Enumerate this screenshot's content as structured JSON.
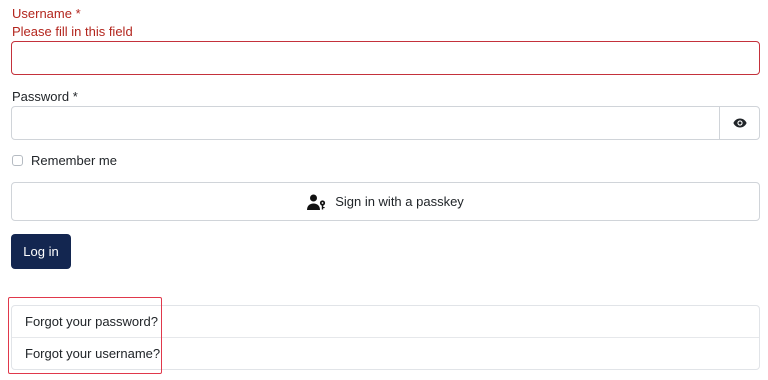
{
  "form": {
    "username_label": "Username *",
    "username_error": "Please fill in this field",
    "username_value": "",
    "password_label": "Password *",
    "password_value": "",
    "remember_label": "Remember me",
    "passkey_label": "Sign in with a passkey",
    "login_label": "Log in"
  },
  "links": [
    {
      "label": "Forgot your password?"
    },
    {
      "label": "Forgot your username?"
    }
  ],
  "colors": {
    "error": "#b3261e",
    "primary_button": "#132650",
    "highlight": "#e0384b"
  },
  "icons": {
    "password_toggle": "eye-icon",
    "passkey": "user-key-icon"
  }
}
